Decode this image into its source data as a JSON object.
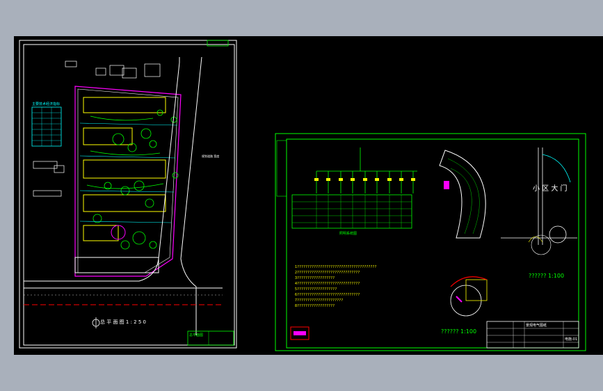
{
  "canvas": {
    "background": "#000000",
    "frame_color": "#a9b0bb"
  },
  "left_sheet": {
    "title_block": "总平面图",
    "scale_text": "总 平 面 图   1 : 2 5 0",
    "notes_heading": "主要技术经济指标",
    "road_label": "规划道路 宽度"
  },
  "right_sheet": {
    "gate_title": "小 区 大 门",
    "plan_scale_1": "?????? 1:100",
    "plan_scale_2": "?????? 1:100",
    "electrical_caption": "照明系统图",
    "notes_lines": [
      "1??????????????????????????????????????",
      "2??????????????????????????????",
      "3??????????????????",
      "4??????????????????????????????",
      "5???????????????????",
      "6??????????????????????????????",
      "7??????????????????????",
      "8??????????????????"
    ],
    "title_block_name": "景观电气图纸",
    "title_block_sheet": "电施-01"
  },
  "colors": {
    "green": "#00ff00",
    "white": "#ffffff",
    "yellow": "#ffff00",
    "red": "#ff0000",
    "magenta": "#ff00ff",
    "cyan": "#00ffff"
  }
}
